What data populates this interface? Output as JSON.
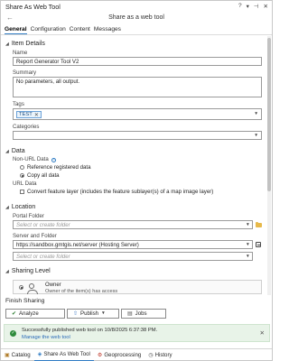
{
  "titlebar": {
    "title": "Share As Web Tool"
  },
  "subtitle": "Share as a web tool",
  "tabs": [
    "General",
    "Configuration",
    "Content",
    "Messages"
  ],
  "sections": {
    "item_details": "Item Details",
    "data": "Data",
    "location": "Location",
    "sharing_level": "Sharing Level"
  },
  "item_details": {
    "name_label": "Name",
    "name_value": "Report Generator Tool V2",
    "summary_label": "Summary",
    "summary_value": "No parameters, all output.",
    "tags_label": "Tags",
    "tags": [
      "TEST"
    ],
    "categories_label": "Categories"
  },
  "data": {
    "non_url_label": "Non-URL Data",
    "options": [
      "Reference registered data",
      "Copy all data"
    ],
    "selected": "Copy all data",
    "url_label": "URL Data",
    "convert_label": "Convert feature layer (includes the feature sublayer(s) of a map image layer)"
  },
  "location": {
    "portal_folder_label": "Portal Folder",
    "portal_folder_placeholder": "Select or create folder",
    "server_folder_label": "Server and Folder",
    "server_value": "https://sandbox.gmtgis.net/server (Hosting Server)",
    "server_folder_placeholder": "Select or create folder"
  },
  "sharing": {
    "owner_title": "Owner",
    "owner_desc": "Owner of the item(s) has access"
  },
  "finish": {
    "title": "Finish Sharing",
    "analyze": "Analyze",
    "publish": "Publish",
    "jobs": "Jobs"
  },
  "message": {
    "text": "Successfully published web tool on 10/8/2025 6:37:38 PM.",
    "link": "Manage the web tool"
  },
  "bottom_tabs": [
    "Catalog",
    "Share As Web Tool",
    "Geoprocessing",
    "History"
  ]
}
